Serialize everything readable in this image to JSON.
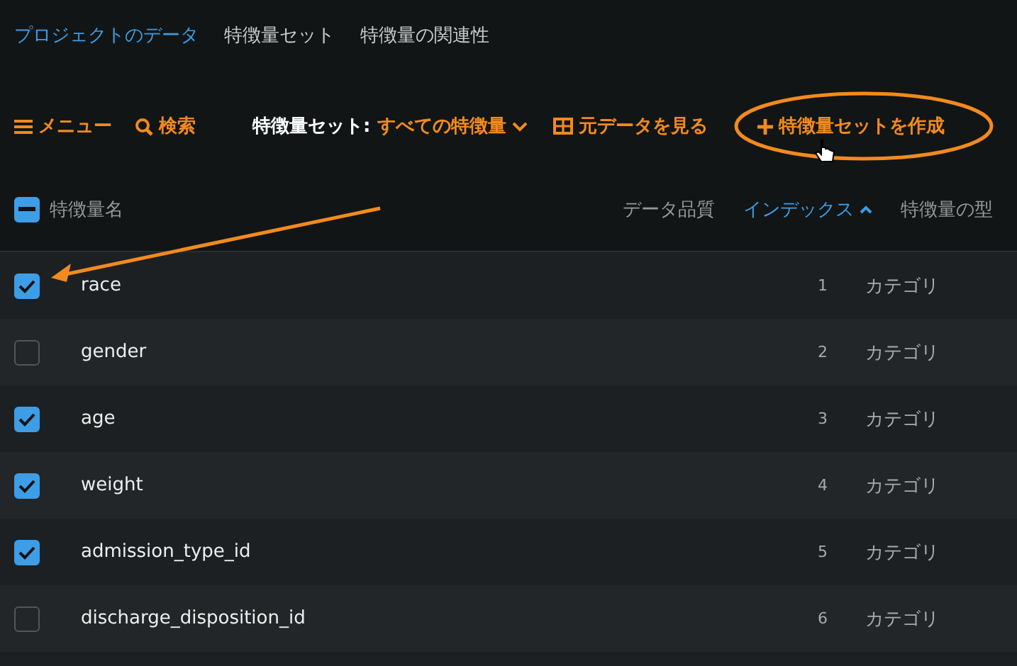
{
  "tabs": [
    {
      "label": "プロジェクトのデータ",
      "selected": true
    },
    {
      "label": "特徴量セット",
      "selected": false
    },
    {
      "label": "特徴量の関連性",
      "selected": false
    }
  ],
  "toolbar": {
    "menu": "メニュー",
    "search": "検索",
    "set_label": "特徴量セット:",
    "set_value": "すべての特徴量",
    "view_raw": "元データを見る",
    "create_set": "特徴量セットを作成"
  },
  "table": {
    "select_all_partial": true,
    "columns": [
      {
        "label": "特徴量名",
        "sorted": false
      },
      {
        "label": "データ品質",
        "sorted": false
      },
      {
        "label": "インデックス",
        "sorted": true
      },
      {
        "label": "特徴量の型",
        "sorted": false
      }
    ],
    "rows": [
      {
        "name": "race",
        "index": "1",
        "type": "カテゴリ",
        "checked": true
      },
      {
        "name": "gender",
        "index": "2",
        "type": "カテゴリ",
        "checked": false
      },
      {
        "name": "age",
        "index": "3",
        "type": "カテゴリ",
        "checked": true
      },
      {
        "name": "weight",
        "index": "4",
        "type": "カテゴリ",
        "checked": true
      },
      {
        "name": "admission_type_id",
        "index": "5",
        "type": "カテゴリ",
        "checked": true
      },
      {
        "name": "discharge_disposition_id",
        "index": "6",
        "type": "カテゴリ",
        "checked": false
      }
    ]
  }
}
